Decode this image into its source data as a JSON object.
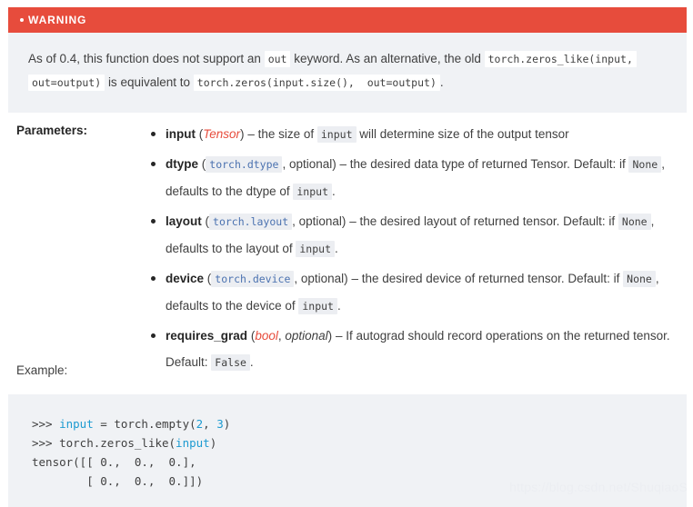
{
  "warning": {
    "title": "WARNING",
    "bullet_icon": "dot-icon",
    "accent_color": "#e74c3c",
    "background_color": "#f0f2f5",
    "text_part_1": "As of 0.4, this function does not support an",
    "code_1": "out",
    "text_part_2": "keyword. As an alternative, the old",
    "code_2": "torch.zeros_like(input,",
    "code_3": "out=output)",
    "text_part_3": "is equivalent to",
    "code_4": "torch.zeros(input.size(),  out=output)",
    "text_part_4": "."
  },
  "parameters": {
    "label": "Parameters:",
    "items": [
      {
        "name": "input",
        "open_paren": "(",
        "type": "Tensor",
        "type_style": "red-italic",
        "close_paren": ")",
        "dash": "– the size of",
        "code_1": "input",
        "tail_1": "will determine size of the output tensor",
        "code_2": "",
        "tail_2": ""
      },
      {
        "name": "dtype",
        "open_paren": "(",
        "type": "torch.dtype",
        "type_style": "blue-mono",
        "optional": ", optional)",
        "dash": "– the desired data type of returned Tensor. Default: if",
        "code_1": "None",
        "tail_1": ", defaults to the dtype of",
        "code_2": "input",
        "tail_2": "."
      },
      {
        "name": "layout",
        "open_paren": "(",
        "type": "torch.layout",
        "type_style": "blue-mono",
        "optional": ", optional)",
        "dash": "– the desired layout of returned tensor. Default: if",
        "code_1": "None",
        "tail_1": ", defaults to the layout of",
        "code_2": "input",
        "tail_2": "."
      },
      {
        "name": "device",
        "open_paren": "(",
        "type": "torch.device",
        "type_style": "blue-mono",
        "optional": ", optional)",
        "dash": "– the desired device of returned tensor. Default: if",
        "code_1": "None",
        "tail_1": ", defaults to the device of",
        "code_2": "input",
        "tail_2": "."
      },
      {
        "name": "requires_grad",
        "open_paren": "(",
        "type": "bool",
        "type_style": "red-italic",
        "optional_em": "optional",
        "comma": ",",
        "close_paren": ")",
        "dash": "– If autograd should record operations on the returned tensor. Default:",
        "code_1": "False",
        "tail_1": ".",
        "code_2": "",
        "tail_2": ""
      }
    ]
  },
  "example": {
    "label": "Example:",
    "background_color": "#f0f2f5",
    "lines": [
      {
        "prompt": ">>> ",
        "name": "input",
        "op": " = torch.empty(",
        "num1": "2",
        "sep": ", ",
        "num2": "3",
        "end": ")"
      },
      {
        "prompt": ">>> ",
        "op": "torch.zeros_like(",
        "name": "input",
        "end": ")"
      },
      {
        "output": "tensor([[ 0.,  0.,  0.],"
      },
      {
        "output": "        [ 0.,  0.,  0.]])"
      }
    ]
  },
  "watermark": {
    "text": "https://blog.csdn.net/ShuqiaoS"
  }
}
